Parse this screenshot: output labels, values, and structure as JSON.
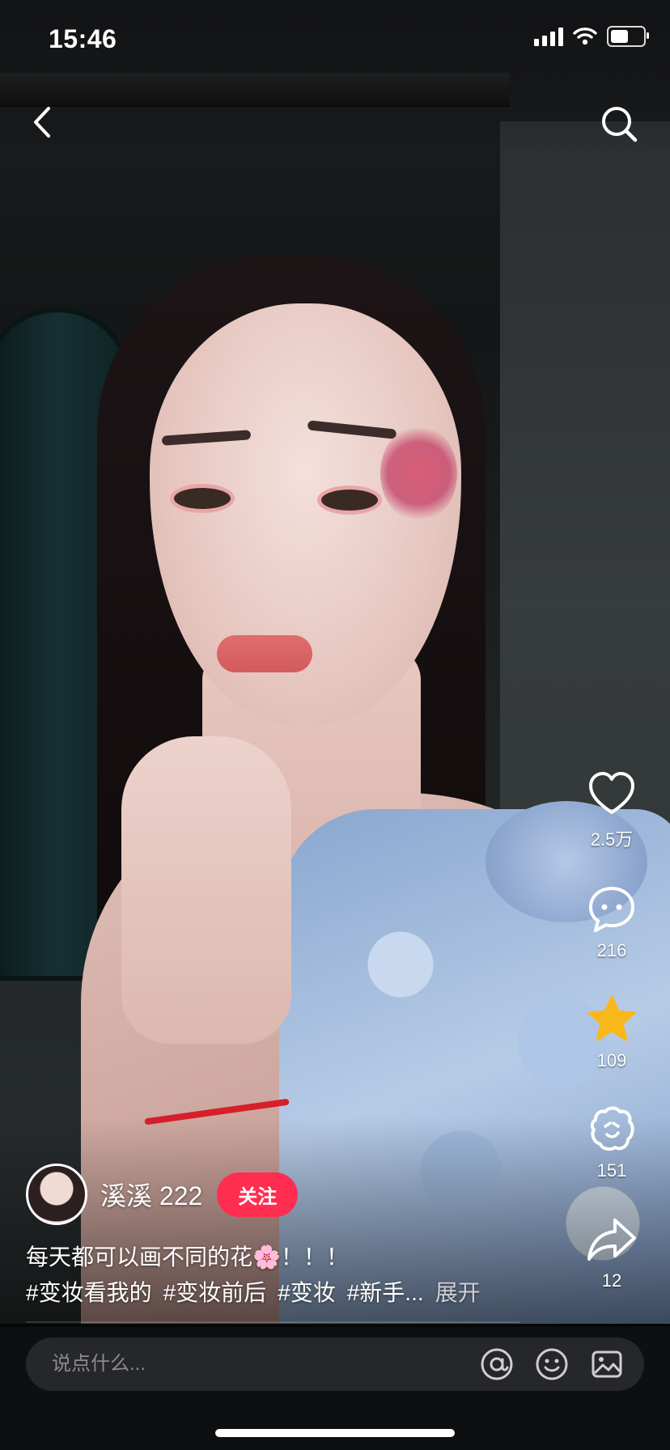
{
  "status": {
    "time": "15:46",
    "battery_level": 0.55
  },
  "nav": {
    "back_icon": "chevron-left-icon",
    "search_icon": "search-icon"
  },
  "rail": {
    "like": {
      "count": "2.5万",
      "icon": "heart-icon"
    },
    "comment": {
      "count": "216",
      "icon": "comment-bubble-icon"
    },
    "favorite": {
      "count": "109",
      "icon": "star-icon",
      "color": "#f9b81a"
    },
    "collab": {
      "count": "151",
      "icon": "collab-mascot-icon"
    },
    "share": {
      "count": "12",
      "icon": "share-arrow-icon"
    }
  },
  "author": {
    "name": "溪溪 222",
    "follow_label": "关注",
    "follow_color": "#ff2d4f"
  },
  "post": {
    "caption": "每天都可以画不同的花🌸！！！",
    "tags": [
      "#变妆看我的",
      "#变妆前后",
      "#变妆",
      "#新手..."
    ],
    "expand_label": "展开"
  },
  "comment_bar": {
    "placeholder": "说点什么...",
    "mention_icon": "at-icon",
    "emoji_icon": "emoji-icon",
    "image_icon": "image-icon"
  }
}
